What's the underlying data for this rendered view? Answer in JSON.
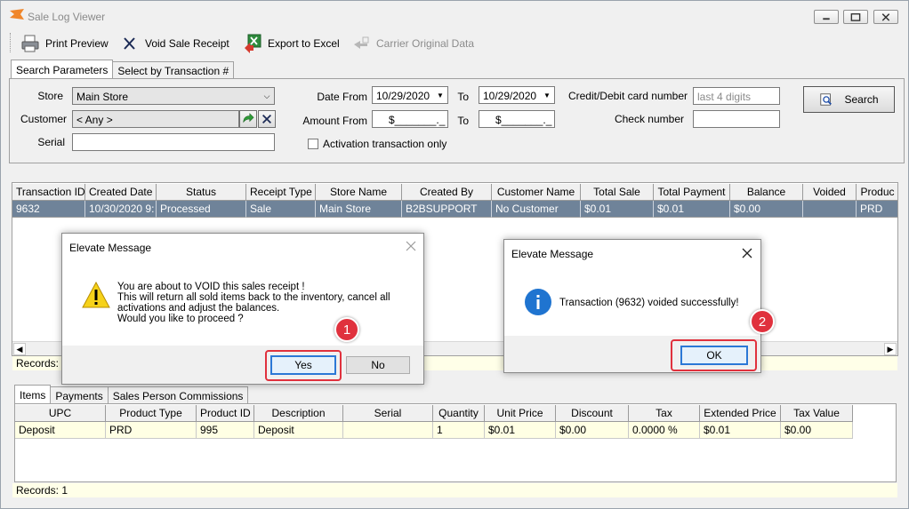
{
  "window": {
    "title": "Sale Log Viewer"
  },
  "toolbar": {
    "print_preview": "Print Preview",
    "void_sale_receipt": "Void Sale Receipt",
    "export_to_excel": "Export to Excel",
    "carrier_original_data": "Carrier Original Data"
  },
  "search_tabs": [
    "Search Parameters",
    "Select by Transaction #"
  ],
  "search": {
    "store_label": "Store",
    "store_value": "Main Store",
    "customer_label": "Customer",
    "customer_value": "< Any >",
    "serial_label": "Serial",
    "serial_value": "",
    "date_from_label": "Date From",
    "date_from_value": "10/29/2020",
    "to_label": "To",
    "date_to_value": "10/29/2020",
    "amount_from_label": "Amount From",
    "amount_from_value": "$_______._",
    "amount_to_value": "$_______._",
    "activation_only_label": "Activation transaction only",
    "card_number_label": "Credit/Debit card number",
    "card_number_placeholder": "last 4 digits",
    "check_number_label": "Check number",
    "check_number_value": "",
    "search_button": "Search"
  },
  "transactions": {
    "columns": [
      "Transaction ID",
      "Created Date",
      "Status",
      "Receipt Type",
      "Store Name",
      "Created By",
      "Customer Name",
      "Total Sale",
      "Total Payment",
      "Balance",
      "Voided",
      "Produc"
    ],
    "rows": [
      [
        "9632",
        "10/30/2020 9:",
        "Processed",
        "Sale",
        "Main Store",
        "B2BSUPPORT",
        "No Customer",
        "$0.01",
        "$0.01",
        "$0.00",
        "",
        "PRD"
      ]
    ],
    "records": "Records: 1"
  },
  "detail_tabs": [
    "Items",
    "Payments",
    "Sales Person Commissions"
  ],
  "items": {
    "columns": [
      "UPC",
      "Product Type",
      "Product ID",
      "Description",
      "Serial",
      "Quantity",
      "Unit Price",
      "Discount",
      "Tax",
      "Extended Price",
      "Tax Value"
    ],
    "rows": [
      [
        "Deposit",
        "PRD",
        "995",
        "Deposit",
        "",
        "1",
        "$0.01",
        "$0.00",
        "0.0000 %",
        "$0.01",
        "$0.00"
      ]
    ],
    "records": "Records: 1"
  },
  "confirm_dialog": {
    "title": "Elevate Message",
    "lines": [
      "You are about to VOID this sales receipt !",
      "This will return all sold items back to the inventory, cancel all",
      "activations and adjust the balances.",
      "Would you like to proceed ?"
    ],
    "yes": "Yes",
    "no": "No",
    "step": "1"
  },
  "info_dialog": {
    "title": "Elevate Message",
    "message": "Transaction (9632) voided successfully!",
    "ok": "OK",
    "step": "2"
  },
  "colors": {
    "selected_row": "#6f8399",
    "highlight": "#e0313d",
    "items_row": "#ffffe4"
  }
}
